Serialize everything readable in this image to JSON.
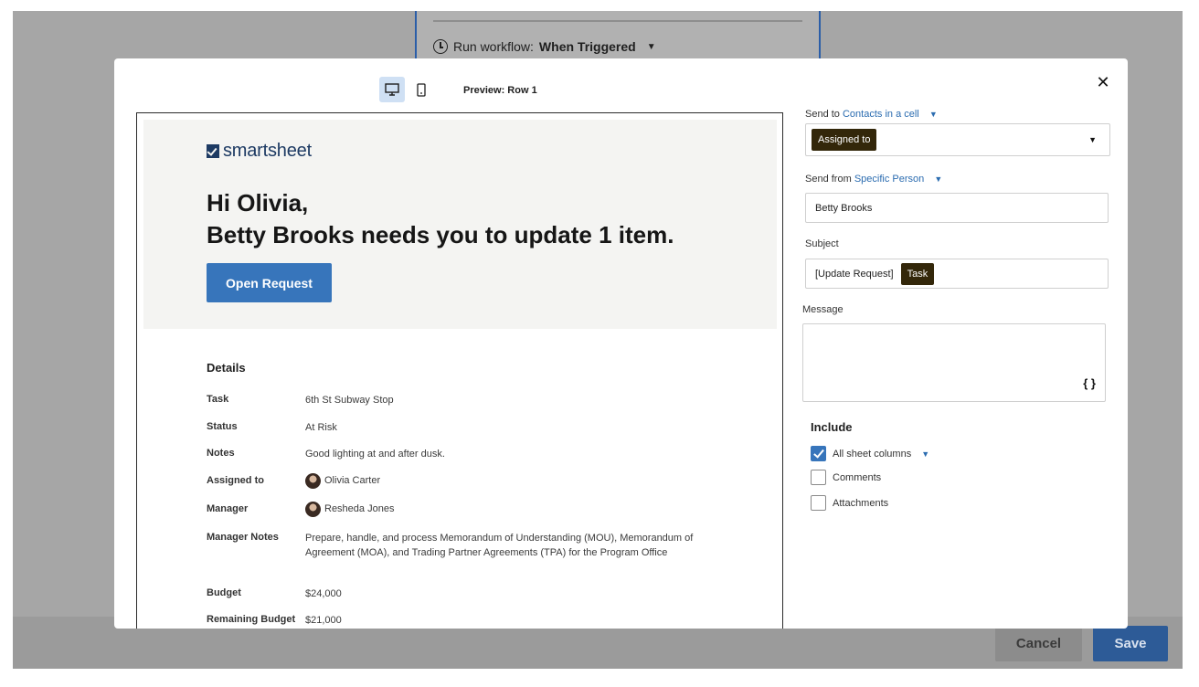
{
  "background": {
    "run_workflow_label": "Run workflow:",
    "run_workflow_value": "When Triggered",
    "cancel_label": "Cancel",
    "save_label": "Save"
  },
  "modal": {
    "preview_label": "Preview: Row 1",
    "close_symbol": "✕",
    "view_modes": [
      "desktop",
      "mobile"
    ],
    "active_view": "desktop"
  },
  "email": {
    "logo_text": "smartsheet",
    "greeting_line1": "Hi Olivia,",
    "greeting_line2": "Betty Brooks needs you to update 1 item.",
    "button_label": "Open Request",
    "details_title": "Details",
    "details": [
      {
        "key": "Task",
        "value": "6th St Subway Stop"
      },
      {
        "key": "Status",
        "value": "At Risk"
      },
      {
        "key": "Notes",
        "value": "Good lighting at and after dusk."
      },
      {
        "key": "Assigned to",
        "value": "Olivia Carter"
      },
      {
        "key": "Manager",
        "value": "Resheda Jones"
      },
      {
        "key": "Manager Notes",
        "value": "Prepare, handle, and process Memorandum of Understanding (MOU), Memorandum of Agreement (MOA), and Trading Partner Agreements (TPA) for the Program Office"
      },
      {
        "key": "Budget",
        "value": "$24,000"
      },
      {
        "key": "Remaining Budget",
        "value": "$21,000"
      }
    ]
  },
  "panel": {
    "send_to_label": "Send to",
    "send_to_link": "Contacts in a cell",
    "send_to_tag": "Assigned to",
    "send_from_label": "Send from",
    "send_from_link": "Specific Person",
    "send_from_value": "Betty Brooks",
    "subject_label": "Subject",
    "subject_text": "[Update Request]",
    "subject_tag": "Task",
    "message_label": "Message",
    "message_value": "",
    "braces_symbol": "{ }",
    "include_title": "Include",
    "include_options": [
      {
        "label": "All sheet columns",
        "checked": true
      },
      {
        "label": "Comments",
        "checked": false
      },
      {
        "label": "Attachments",
        "checked": false
      }
    ]
  },
  "colors": {
    "accent": "#3775bb",
    "link": "#2b6cb0",
    "tag_bg": "#33270a",
    "overlay": "#a6a6a6"
  }
}
